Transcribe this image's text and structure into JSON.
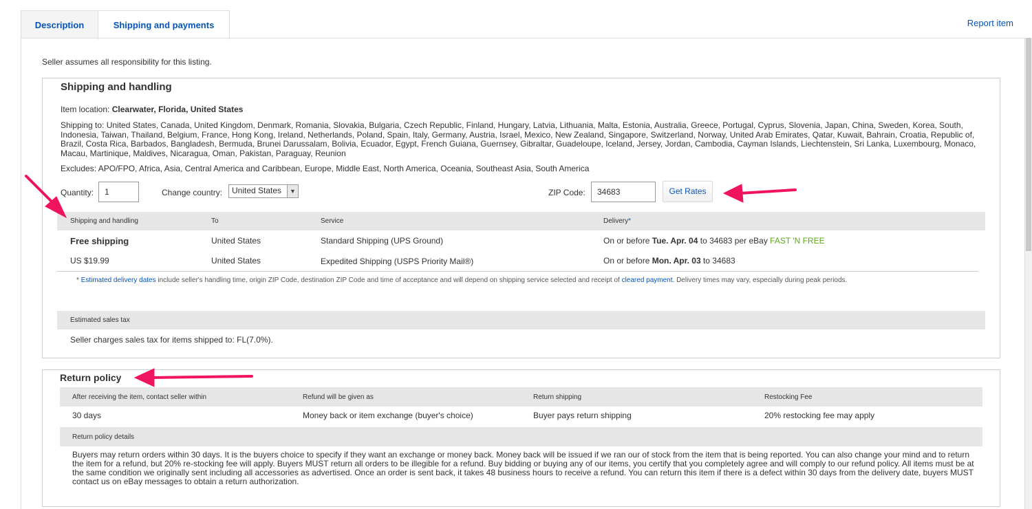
{
  "tabs": [
    {
      "label": "Description"
    },
    {
      "label": "Shipping and payments"
    }
  ],
  "report_link": "Report item",
  "intro": "Seller assumes all responsibility for this listing.",
  "shipping": {
    "title": "Shipping and handling",
    "item_location_label": "Item location:",
    "item_location": "Clearwater, Florida, United States",
    "ships_to": "Shipping to: United States, Canada, United Kingdom, Denmark, Romania, Slovakia, Bulgaria, Czech Republic, Finland, Hungary, Latvia, Lithuania, Malta, Estonia, Australia, Greece, Portugal, Cyprus, Slovenia, Japan, China, Sweden, Korea, South, Indonesia, Taiwan, Thailand, Belgium, France, Hong Kong, Ireland, Netherlands, Poland, Spain, Italy, Germany, Austria, Israel, Mexico, New Zealand, Singapore, Switzerland, Norway, United Arab Emirates, Qatar, Kuwait, Bahrain, Croatia, Republic of, Brazil, Costa Rica, Barbados, Bangladesh, Bermuda, Brunei Darussalam, Bolivia, Ecuador, Egypt, French Guiana, Guernsey, Gibraltar, Guadeloupe, Iceland, Jersey, Jordan, Cambodia, Cayman Islands, Liechtenstein, Sri Lanka, Luxembourg, Monaco, Macau, Martinique, Maldives, Nicaragua, Oman, Pakistan, Paraguay, Reunion",
    "excludes": "Excludes: APO/FPO, Africa, Asia, Central America and Caribbean, Europe, Middle East, North America, Oceania, Southeast Asia, South America",
    "quantity_label": "Quantity:",
    "quantity_value": "1",
    "country_label": "Change country:",
    "country_value": "United States",
    "zip_label": "ZIP Code:",
    "zip_value": "34683",
    "get_rates": "Get Rates",
    "columns": [
      "Shipping and handling",
      "To",
      "Service",
      "Delivery"
    ],
    "delivery_asterisk": "*",
    "rows": [
      {
        "cost": "Free shipping",
        "to": "United States",
        "service": "Standard Shipping (UPS Ground)",
        "delivery_prefix": "On or before ",
        "delivery_date": "Tue. Apr. 04",
        "delivery_suffix": " to 34683 per eBay ",
        "badge": "FAST 'N FREE"
      },
      {
        "cost": "US $19.99",
        "to": "United States",
        "service": "Expedited Shipping (USPS Priority Mail®)",
        "delivery_prefix": "On or before ",
        "delivery_date": "Mon. Apr. 03",
        "delivery_suffix": " to 34683",
        "badge": ""
      }
    ],
    "note_star": "* ",
    "note_link1": "Estimated delivery dates",
    "note_mid": " include seller's handling time, origin ZIP Code, destination ZIP Code and time of acceptance and will depend on shipping service selected and receipt of ",
    "note_link2": "cleared payment",
    "note_end": ". Delivery times may vary, especially during peak periods.",
    "tax_header": "Estimated sales tax",
    "tax_text": "Seller charges sales tax for items shipped to: FL(7.0%)."
  },
  "returns": {
    "title": "Return policy",
    "columns": [
      "After receiving the item, contact seller within",
      "Refund will be given as",
      "Return shipping",
      "Restocking Fee"
    ],
    "values": [
      "30 days",
      "Money back or item exchange (buyer's choice)",
      "Buyer pays return shipping",
      "20% restocking fee may apply"
    ],
    "details_header": "Return policy details",
    "details": "Buyers may return orders within 30 days. It is the buyers choice to specify if they want an exchange or money back. Money back will be issued if we ran our of stock from the item that is being reported. You can also change your mind and to return the item for a refund, but 20% re-stocking fee will apply. Buyers MUST return all orders to be illegible for a refund. Buy bidding or buying any of our items, you certify that you completely agree and will comply to our refund policy. All items must be at the same condition we originally sent including all accessories as advertised. Once an order is sent back, it takes 48 business hours to receive a refund. You can return this item if there is a defect within 30 days from the delivery date, buyers MUST contact us on eBay messages to obtain a return authorization."
  },
  "colors": {
    "link": "#0654ba",
    "fast_free": "#5ba71b",
    "annotation_arrow": "#f0135f"
  }
}
